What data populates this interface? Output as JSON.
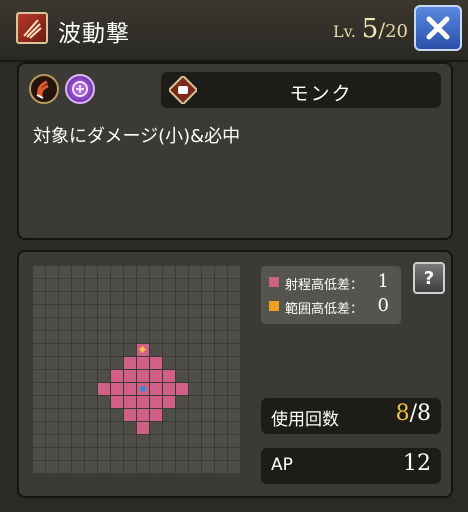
{
  "header": {
    "skill_icon": "slash-claw-icon",
    "skill_name": "波動撃",
    "level_label": "Lv.",
    "level_current": "5",
    "level_sep": "/",
    "level_max": "20",
    "close_icon": "close-x-icon"
  },
  "info": {
    "weapon_icon": "weapon-type-icon",
    "magic_icon": "magic-element-icon",
    "job_icon": "fist-icon",
    "job_name": "モンク",
    "description": "対象にダメージ(小)&必中"
  },
  "range": {
    "legend": [
      {
        "label": "射程高低差：",
        "value": "1",
        "color": "#d06088"
      },
      {
        "label": "範囲高低差：",
        "value": "0",
        "color": "#f0a020"
      }
    ],
    "help_label": "?"
  },
  "stats": {
    "uses_label": "使用回数",
    "uses_current": "8",
    "uses_sep": "/",
    "uses_max": "8",
    "ap_label": "AP",
    "ap_value": "12"
  },
  "colors": {
    "accent_gold": "#f0c040",
    "range_pink": "#d06088",
    "close_blue": "#3a64c6"
  }
}
